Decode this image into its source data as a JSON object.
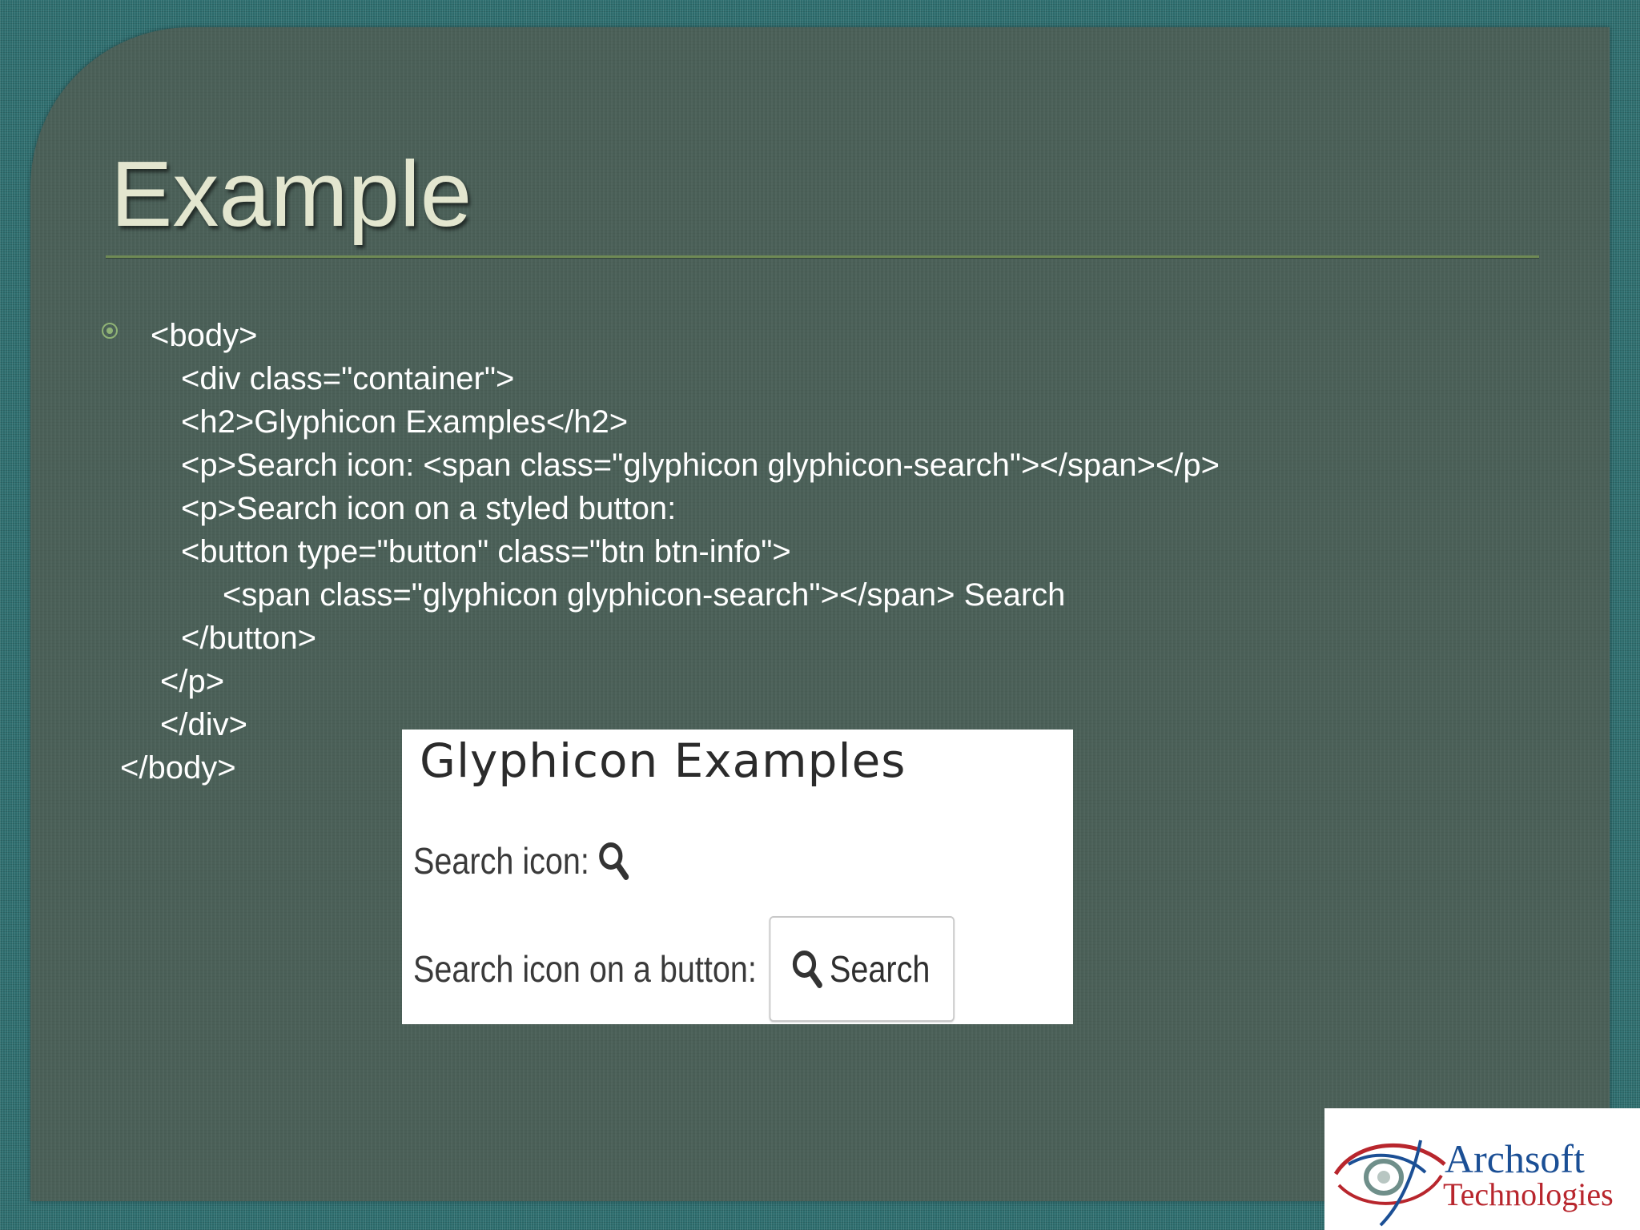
{
  "slide": {
    "title": "Example",
    "code_lines": [
      "<body>",
      "<div class=\"container\">",
      "<h2>Glyphicon Examples</h2>",
      "<p>Search icon: <span class=\"glyphicon glyphicon-search\"></span></p>",
      "<p>Search icon on a styled button:",
      "<button type=\"button\" class=\"btn btn-info\">",
      "<span class=\"glyphicon glyphicon-search\"></span> Search",
      "</button>",
      "</p>",
      "</div>",
      "</body>"
    ],
    "bullet_icon": "circle-dot-bullet-icon"
  },
  "example": {
    "heading": "Glyphicon Examples",
    "search_icon_label": "Search icon:",
    "button_row_label": "Search icon on a button:",
    "button_label": "Search",
    "icon": "magnifier-icon"
  },
  "logo": {
    "name": "Archsoft",
    "sub": "Technologies"
  },
  "colors": {
    "slide_bg": "#4a5f57",
    "outer_bg": "#2f6f70",
    "title": "#e3e6cf",
    "rule": "#6f8a55",
    "logo_blue": "#1b4f95",
    "logo_red": "#b8262d"
  }
}
